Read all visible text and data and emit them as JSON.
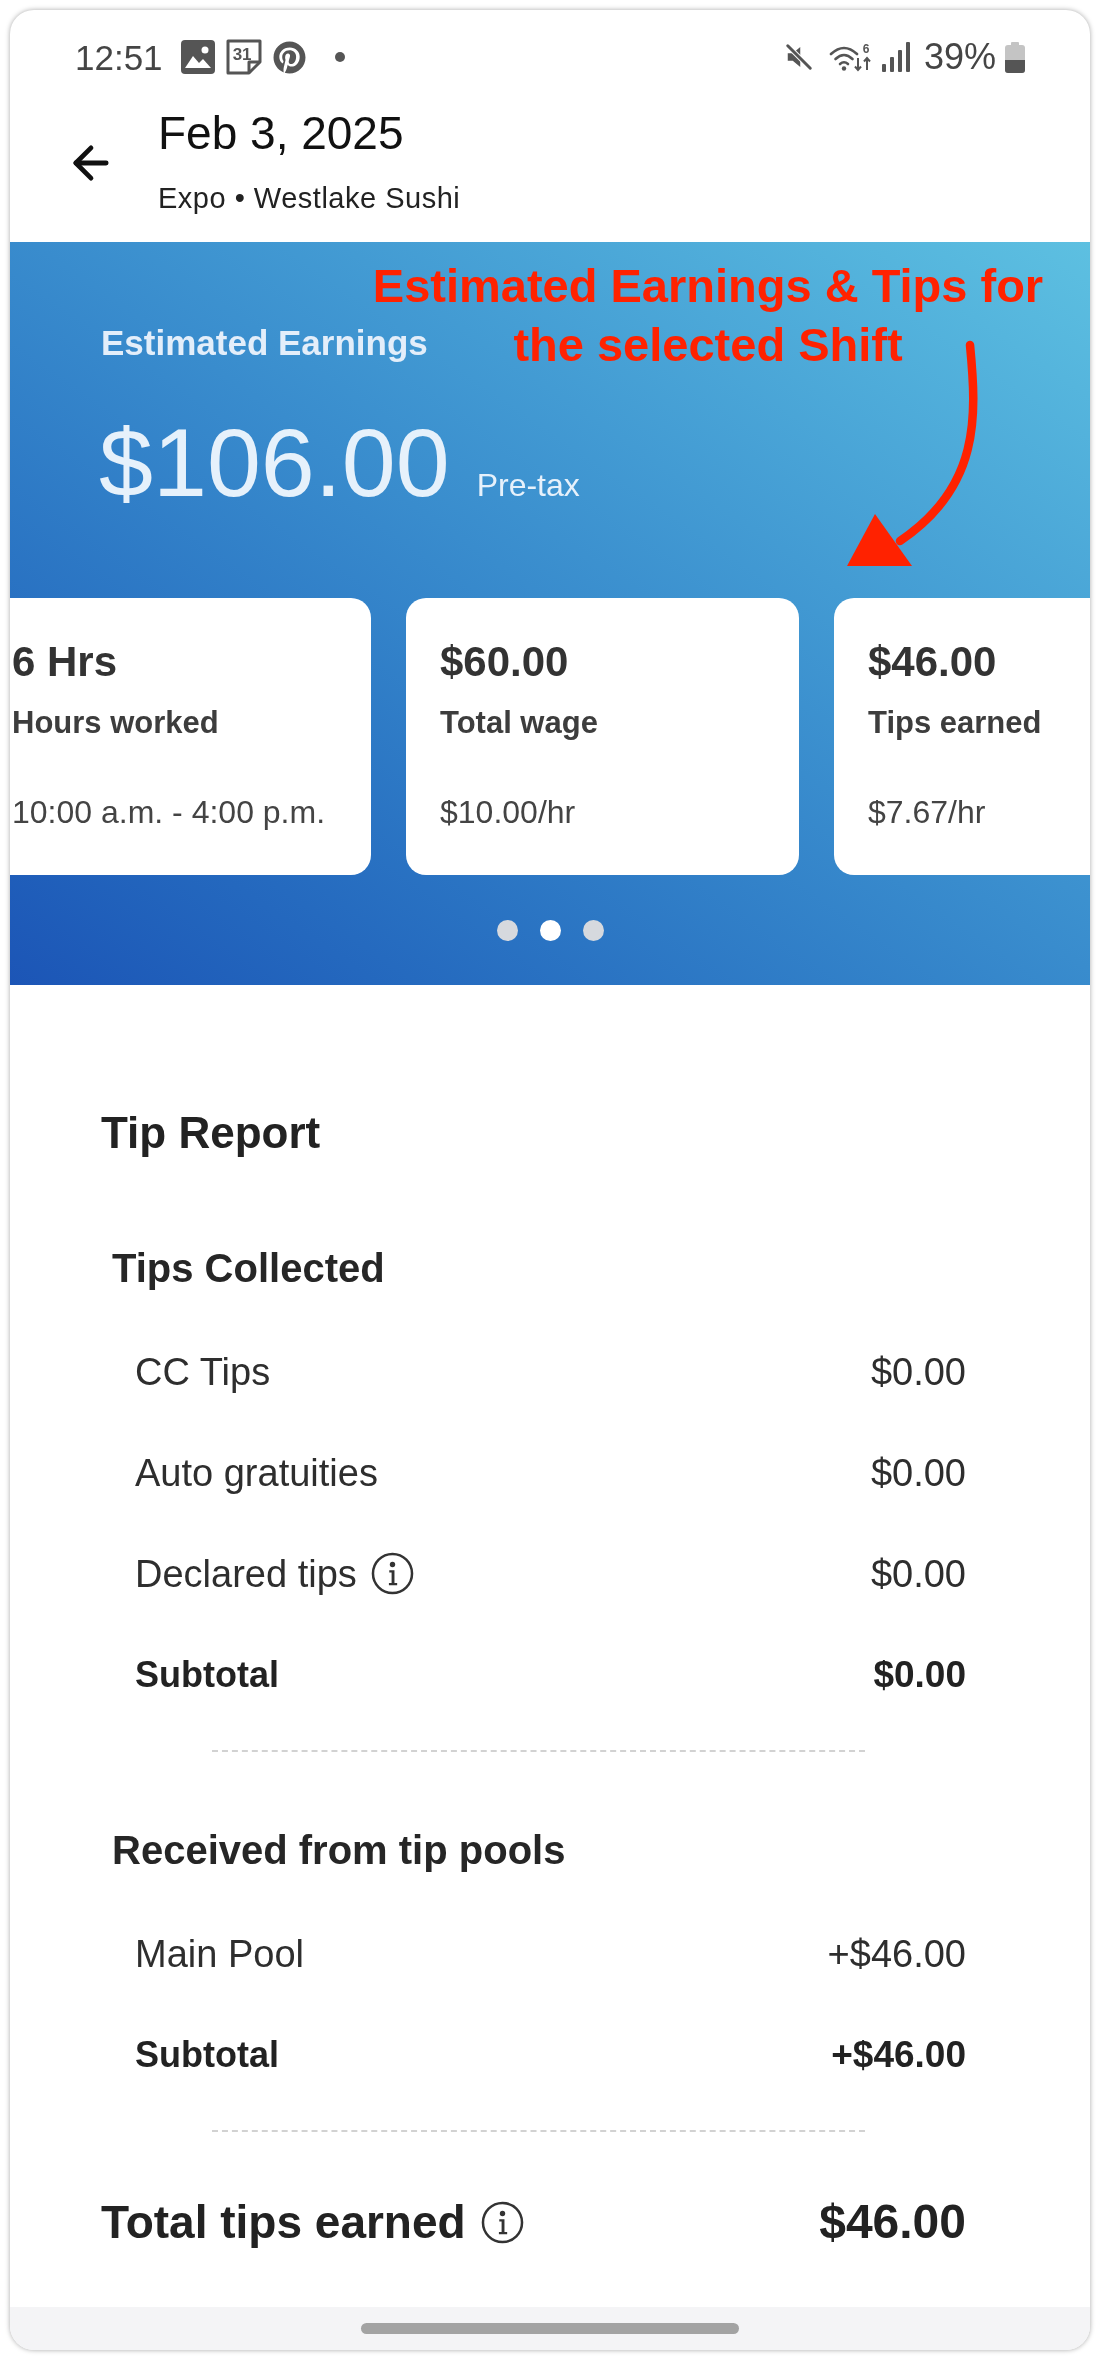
{
  "status_bar": {
    "time": "12:51",
    "calendar_day": "31",
    "wifi_label": "6",
    "battery": "39%"
  },
  "header": {
    "title": "Feb 3, 2025",
    "subtitle": "Expo • Westlake Sushi"
  },
  "earnings": {
    "label": "Estimated Earnings",
    "amount": "$106.00",
    "note": "Pre-tax",
    "cards": [
      {
        "value": "6 Hrs",
        "label": "Hours worked",
        "detail": "10:00 a.m. - 4:00 p.m."
      },
      {
        "value": "$60.00",
        "label": "Total wage",
        "detail": "$10.00/hr"
      },
      {
        "value": "$46.00",
        "label": "Tips earned",
        "detail": "$7.67/hr"
      }
    ],
    "pager": [
      {
        "selected": false
      },
      {
        "selected": true
      },
      {
        "selected": false
      }
    ]
  },
  "annotation": {
    "lines": [
      "Estimated Earnings & Tips for",
      "the selected Shift"
    ]
  },
  "tip_report": {
    "title": "Tip Report",
    "sections": [
      {
        "title": "Tips Collected",
        "rows": [
          {
            "label": "CC Tips",
            "value": "$0.00",
            "kind": "item",
            "has_info": false
          },
          {
            "label": "Auto gratuities",
            "value": "$0.00",
            "kind": "item",
            "has_info": false
          },
          {
            "label": "Declared tips",
            "value": "$0.00",
            "kind": "item",
            "has_info": true
          },
          {
            "label": "Subtotal",
            "value": "$0.00",
            "kind": "subtotal",
            "has_info": false
          }
        ]
      },
      {
        "title": "Received from tip pools",
        "rows": [
          {
            "label": "Main Pool",
            "value": "+$46.00",
            "kind": "item",
            "has_info": false
          },
          {
            "label": "Subtotal",
            "value": "+$46.00",
            "kind": "subtotal",
            "has_info": false
          }
        ]
      }
    ],
    "total": {
      "label": "Total tips earned",
      "value": "$46.00",
      "has_info": true
    }
  }
}
